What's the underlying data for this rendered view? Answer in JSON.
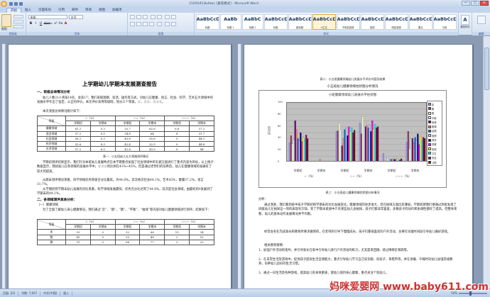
{
  "window": {
    "title": "15050453b4doc [兼容模式] - Microsoft Word",
    "controls": [
      "—",
      "▢",
      "✕"
    ]
  },
  "ribbon": {
    "tabs": [
      "开始",
      "插入",
      "页面布局",
      "引用",
      "邮件",
      "审阅",
      "视图",
      "加载项"
    ],
    "font_name": "宋体",
    "font_size": "五号",
    "format_buttons": [
      "B",
      "I",
      "U",
      "abe",
      "x₂",
      "x²",
      "Aa",
      "A"
    ],
    "groups": {
      "clipboard": "剪贴板",
      "font": "字体",
      "paragraph": "段落",
      "styles": "样式",
      "editing": "编辑"
    },
    "paste_label": "粘贴",
    "styles": [
      {
        "sample": "AaBbCcDc",
        "name": "标题"
      },
      {
        "sample": "AaBb",
        "name": "标题 1"
      },
      {
        "sample": "AaBbC",
        "name": "标题 2"
      },
      {
        "sample": "AaBbCcD",
        "name": "标题"
      },
      {
        "sample": "AaBbCcDc",
        "name": "副标题"
      },
      {
        "sample": "AaBbCcDc",
        "name": "↵正文",
        "selected": true
      },
      {
        "sample": "AaBbCcDc",
        "name": "不明显强调"
      },
      {
        "sample": "AaBbCcDc",
        "name": "强调"
      },
      {
        "sample": "AaBbCcDc",
        "name": "明显强调"
      },
      {
        "sample": "AaBbCcDc",
        "name": "要点"
      },
      {
        "sample": "AaBbCcDc",
        "name": "引用"
      }
    ],
    "change_styles": "更改样式",
    "editing": "编辑"
  },
  "page1": {
    "title": "上学期幼儿学期末发展测查报告",
    "section1": "一、班级总体情况分析",
    "para1": "幼儿人数31人男孩14名、女孩17；我们采取观察、谈话、操作等方式，对幼儿在健康、语言、社会、科学、艺术五大领域中的发展水平作出了鉴定、公正的评价。本次评价采用等级制，划分三个等级，☆、☆☆、☆☆☆。",
    "para2": "本次测查总体情况统计如下：",
    "table1": {
      "group_headers": [
        "☆（%）",
        "☆☆（%）",
        "☆☆☆（%）"
      ],
      "sub_headers": [
        "领域",
        "学期初",
        "学期末",
        "学期初",
        "学期末",
        "学期初",
        "学期末"
      ],
      "corner": "等级",
      "rows": [
        [
          "健康领域",
          "61.2",
          "0.3",
          "32.7",
          "62.6",
          "6.6",
          "37.2"
        ],
        [
          "语言领域",
          "57.2",
          "0.5",
          "34.8",
          "64",
          "8",
          "31.7"
        ],
        [
          "社会领域",
          "56.2",
          "0.3",
          "43.8",
          "55.6",
          "0",
          "44.1"
        ],
        [
          "科学领域",
          "53.6",
          "8.3",
          "42.4",
          "52.5",
          "0",
          "44.8"
        ],
        [
          "艺术领域",
          "57.2",
          "6.5",
          "42.8",
          "43.5",
          "0",
          "44"
        ]
      ]
    },
    "table1_caption": "表一：小五班幼儿五大领域测评情况",
    "para3": "学期初测评结果显示，我们针对本班幼儿发展特点在本学期重点加强了社会领域中的礼貌方面进行了重点内容为目标，以上统计数据显示，我班幼儿在各领域的发展水平中，☆☆☆的比例在41%~45%，但是通过老师们的培养后，幼儿在健康领域的发展有了较大的提高。",
    "para4": "从期末测评情况来看，科学领域优秀等级百分比最高，为44.8%。其次依次社会44.1%，艺术43%，健康37.2%，语言31.7%。",
    "para5": "从学期初到学期末幼儿发展的对比来看，科学领域发展最快，优秀百分比达到了44.8%，其次是社会领域，由最初的0发展到了学期末的44.1%。",
    "section2": "二、各领域测评具体分析：",
    "subsection": "（一）健康领域",
    "para6": "为了全面了解幼儿身心健康情况，我们通过“走”、“跑”、“跳”、“平衡”、“拍球”等内容对幼儿健康领域进行测评，结果如下：",
    "table2": {
      "group_headers": [
        "☆（%）",
        "☆☆（%）",
        "☆☆☆（%）"
      ],
      "sub_headers": [
        "领域",
        "学期初",
        "学期末",
        "学期初",
        "学期末",
        "学期初",
        "学期末"
      ],
      "corner": "等级",
      "rows": [
        [
          "走",
          "33",
          "0",
          "52",
          "66",
          "15",
          "34"
        ],
        [
          "跑",
          "45",
          "0",
          "53",
          "48",
          "2",
          "52"
        ],
        [
          "跳",
          "31",
          "0",
          "66",
          "77",
          "3",
          "23"
        ]
      ]
    }
  },
  "page2": {
    "chart_caption_top": "表二：小五班健康领域幼儿发展水平评价内容及结果",
    "chart_heading": "小五班幼儿健康领域柱状图分析情况",
    "chart_bottom_caption": "表三：小五班幼儿健康领域柱状图分析情况",
    "analysis_label": "分析：",
    "para1": "通过测查，我们看到班中孩子学期初和学期末的对比发展变化，健康领域的进步很大，但在拍球方面比较薄弱，学期初期我们便通过测查发现了班级幼儿在拍球这一项的表现有欠缺，到了学期末班级中只有某些幼儿会拍球，孩子们都非常喜爱，多数孩子的动作和协调性都有了提高，但整体来看，幼儿的基本动作发展情况并不均衡。",
    "para2": "经常会有在完成家长和教育所要求做到的，在老师的引导下慢慢成长，孩子们都很喜欢的户外活动，主要在早操时间段引导幼儿做好游戏。",
    "subhead": "相关教育策略：",
    "item1": "1、加强户外活动的指导，并引导家长在家中引导幼儿进行户外活动的练习，尤其是来回跳、绕过障碍走和跑等。",
    "item2": "2、在日常生活及游戏中，促进孩子提高生活自理能力，重点引导幼儿学习自己穿衣服、扣扣子、系鞋带等，并在进餐、午睡时对幼儿加强常规教育，培养幼儿良好的生活习惯。",
    "item3": "3、通过一日生活及各种游戏，提高幼儿的身体素质，使幼儿保持身心健康，重点关注个别幼儿。"
  },
  "chart_data": {
    "type": "bar",
    "title": "小班健康领域幼儿发展水平柱状图",
    "xlabel": "",
    "ylabel": "百分比",
    "ylim": [
      0,
      100
    ],
    "yticks": [
      0,
      10,
      20,
      30,
      40,
      50,
      60,
      70,
      80,
      90,
      100
    ],
    "grid": true,
    "legend_position": "right",
    "x_groups": [
      "☆（%）",
      "☆☆（%）",
      "☆☆☆（%）"
    ],
    "categories": [
      "学期初",
      "学期末",
      "学期初",
      "学期末",
      "学期初",
      "学期末"
    ],
    "series": [
      {
        "name": "走",
        "color": "#9999ff",
        "values": [
          33,
          0,
          52,
          66,
          15,
          34
        ]
      },
      {
        "name": "跑",
        "color": "#993366",
        "values": [
          45,
          0,
          53,
          48,
          2,
          52
        ]
      },
      {
        "name": "跳",
        "color": "#ffffcc",
        "values": [
          31,
          0,
          66,
          77,
          3,
          23
        ]
      },
      {
        "name": "平衡",
        "color": "#ccffff",
        "values": [
          38,
          0,
          55,
          60,
          7,
          40
        ]
      },
      {
        "name": "拍球",
        "color": "#660066",
        "values": [
          70,
          0,
          28,
          60,
          2,
          40
        ]
      },
      {
        "name": "跳绳",
        "color": "#ff8080",
        "values": [
          55,
          5,
          40,
          62,
          5,
          33
        ]
      },
      {
        "name": "钻爬",
        "color": "#0066cc",
        "values": [
          40,
          0,
          55,
          58,
          5,
          42
        ]
      },
      {
        "name": "投掷",
        "color": "#ccccff",
        "values": [
          36,
          0,
          58,
          63,
          6,
          37
        ]
      },
      {
        "name": "穿衣",
        "color": "#000080",
        "values": [
          50,
          0,
          45,
          52,
          5,
          48
        ]
      },
      {
        "name": "进餐",
        "color": "#ff00ff",
        "values": [
          35,
          0,
          60,
          70,
          5,
          30
        ]
      },
      {
        "name": "如厕",
        "color": "#ffff00",
        "values": [
          42,
          0,
          52,
          56,
          6,
          44
        ]
      },
      {
        "name": "卫生",
        "color": "#00ffff",
        "values": [
          38,
          0,
          58,
          64,
          4,
          36
        ]
      },
      {
        "name": "安全",
        "color": "#800080",
        "values": [
          46,
          0,
          50,
          58,
          4,
          42
        ]
      },
      {
        "name": "习惯",
        "color": "#800000",
        "values": [
          40,
          0,
          54,
          60,
          6,
          40
        ]
      }
    ]
  },
  "status": {
    "page": "页面: 2/3",
    "words": "字数: 7,937",
    "language": "中文(中国)",
    "mode": "插入",
    "zoom": "50%"
  },
  "watermark": "妈咪爱婴网 www.baby611.com"
}
